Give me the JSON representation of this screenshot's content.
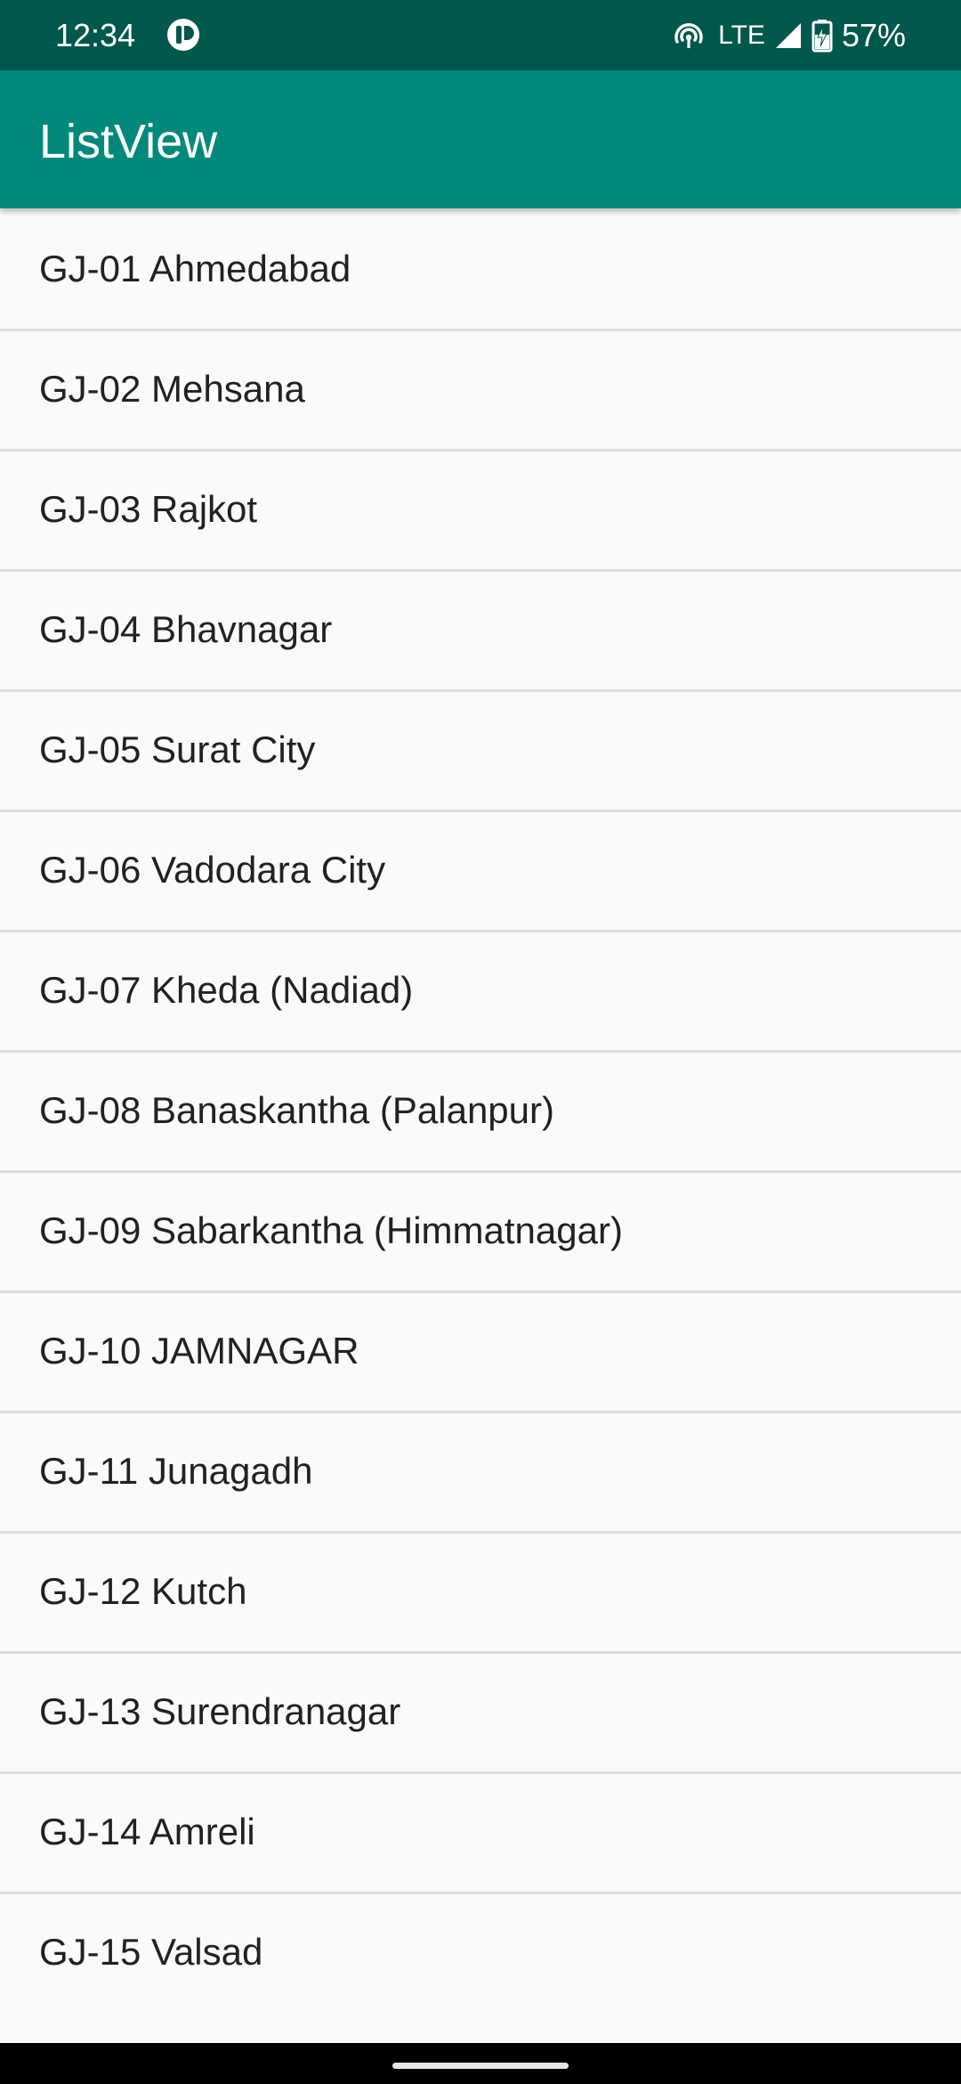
{
  "status_bar": {
    "time": "12:34",
    "network": "LTE",
    "battery": "57%",
    "icons": [
      "app-notification-icon",
      "hotspot-icon",
      "signal-icon",
      "battery-charging-icon"
    ]
  },
  "app_bar": {
    "title": "ListView",
    "color": "#00897b",
    "status_color": "#00574b"
  },
  "list": {
    "items": [
      "GJ-01 Ahmedabad",
      "GJ-02 Mehsana",
      "GJ-03 Rajkot",
      "GJ-04 Bhavnagar",
      "GJ-05 Surat City",
      "GJ-06 Vadodara City",
      "GJ-07 Kheda (Nadiad)",
      "GJ-08 Banaskantha (Palanpur)",
      "GJ-09 Sabarkantha (Himmatnagar)",
      "GJ-10 JAMNAGAR",
      "GJ-11 Junagadh",
      "GJ-12 Kutch",
      "GJ-13 Surendranagar",
      "GJ-14 Amreli",
      "GJ-15 Valsad"
    ]
  }
}
